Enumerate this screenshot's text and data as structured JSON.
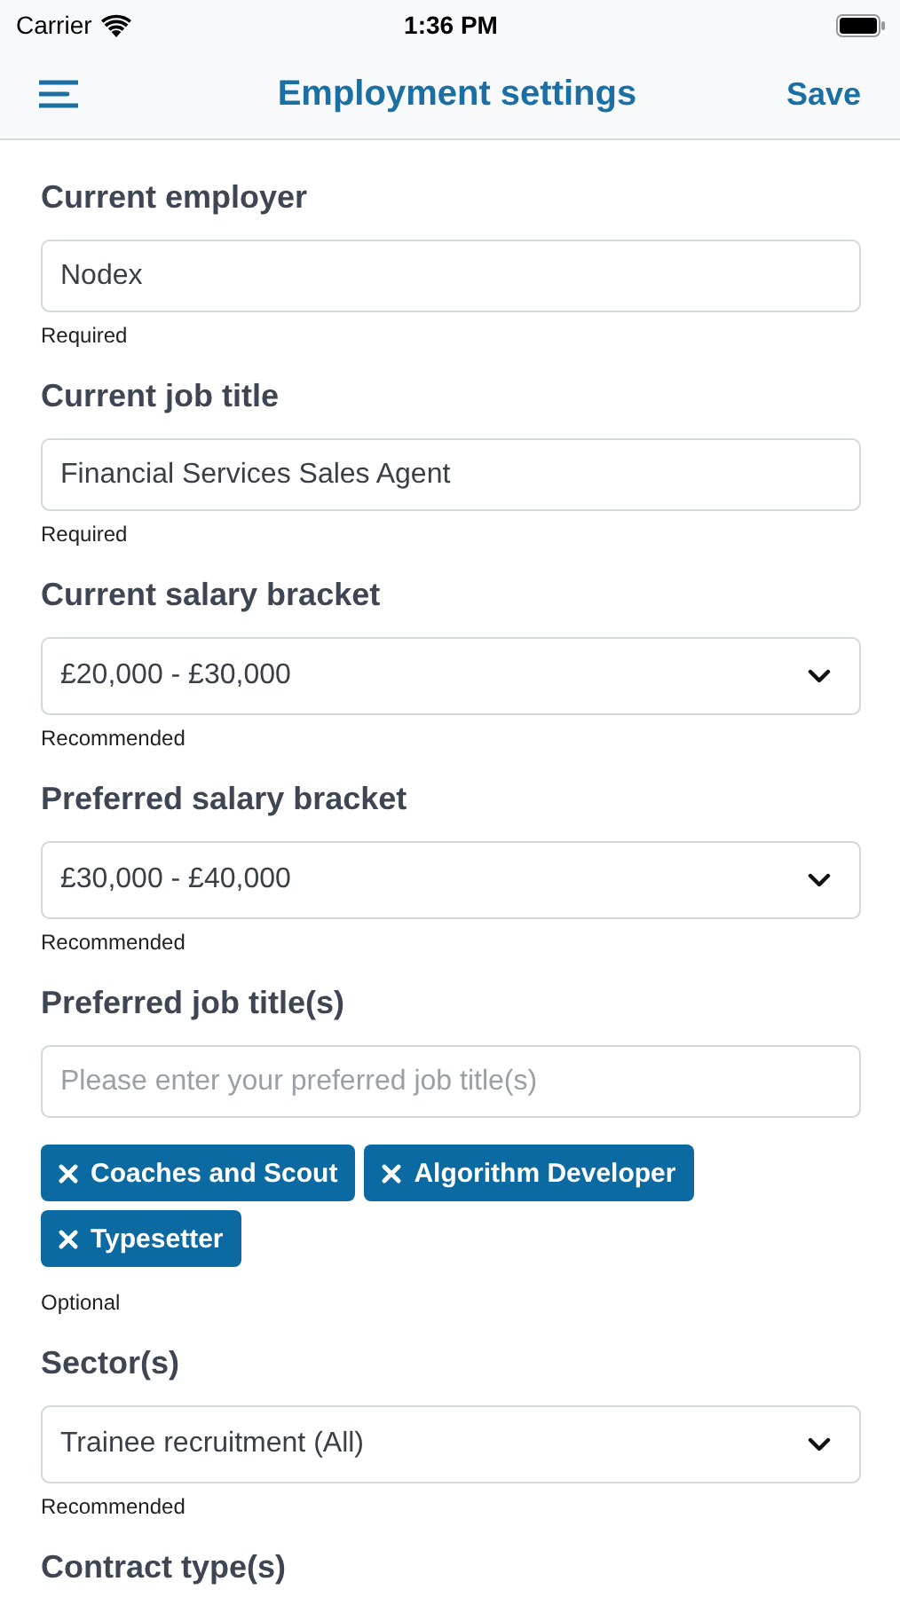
{
  "status_bar": {
    "carrier": "Carrier",
    "time": "1:36 PM"
  },
  "nav": {
    "title": "Employment settings",
    "action": "Save"
  },
  "fields": [
    {
      "kind": "text",
      "label": "Current employer",
      "value": "Nodex",
      "hint": "Required"
    },
    {
      "kind": "text",
      "label": "Current job title",
      "value": "Financial Services Sales Agent",
      "hint": "Required"
    },
    {
      "kind": "select",
      "label": "Current salary bracket",
      "value": "£20,000 - £30,000",
      "hint": "Recommended"
    },
    {
      "kind": "select",
      "label": "Preferred salary bracket",
      "value": "£30,000 - £40,000",
      "hint": "Recommended"
    },
    {
      "kind": "tags",
      "label": "Preferred job title(s)",
      "placeholder": "Please enter your preferred job title(s)",
      "tags": [
        "Coaches and Scout",
        "Algorithm Developer",
        "Typesetter"
      ],
      "hint": "Optional"
    },
    {
      "kind": "select",
      "label": "Sector(s)",
      "value": "Trainee recruitment (All)",
      "hint": "Recommended"
    },
    {
      "kind": "heading",
      "label": "Contract type(s)"
    }
  ]
}
